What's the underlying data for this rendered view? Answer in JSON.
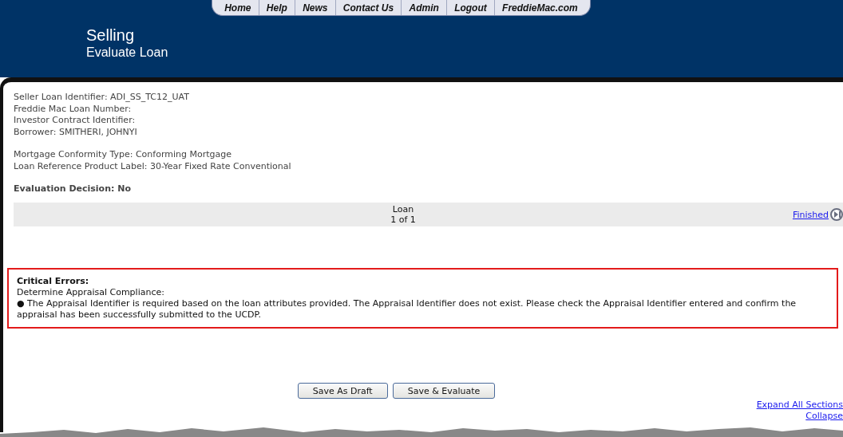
{
  "nav": [
    {
      "label": "Home"
    },
    {
      "label": "Help"
    },
    {
      "label": "News"
    },
    {
      "label": "Contact Us"
    },
    {
      "label": "Admin"
    },
    {
      "label": "Logout"
    },
    {
      "label": "FreddieMac.com"
    }
  ],
  "header": {
    "title": "Selling",
    "subtitle": "Evaluate Loan"
  },
  "loan_info": [
    [
      "Seller Loan Identifier: ADI_SS_TC12_UAT",
      "Freddie Mac Loan Number:",
      "Investor Contract Identifier:",
      "Borrower: SMITHERI, JOHNYI"
    ],
    [
      "Mortgage Conformity Type: Conforming Mortgage",
      "Loan Reference Product Label: 30-Year Fixed Rate Conventional"
    ]
  ],
  "decision": "Evaluation Decision: No",
  "pager": {
    "label": "Loan",
    "position": "1 of 1",
    "finished": "Finished"
  },
  "errors": {
    "title": "Critical Errors:",
    "section": "Determine Appraisal Compliance:",
    "items": [
      {
        "bullet": "●",
        "text": "The Appraisal Identifier is required based on the loan attributes provided. The Appraisal Identifier does not exist. Please check the Appraisal Identifier entered and confirm the appraisal has been successfully submitted to the UCDP."
      }
    ]
  },
  "buttons": [
    "Save As Draft",
    "Save & Evaluate"
  ],
  "links": [
    "Expand All Sections",
    "Collapse"
  ]
}
